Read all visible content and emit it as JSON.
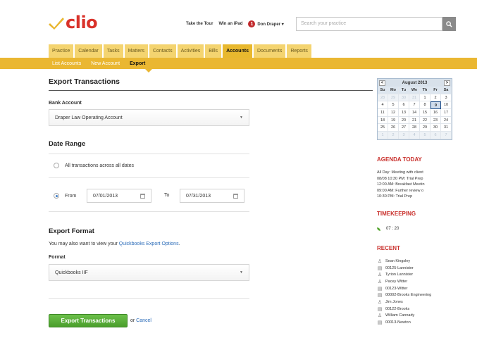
{
  "brand": {
    "name": "clio"
  },
  "top_links": {
    "tour": "Take the Tour",
    "win": "Win an iPad",
    "alert_count": "1",
    "user": "Don Draper ▾"
  },
  "search": {
    "placeholder": "Search your practice"
  },
  "tabs": [
    {
      "label": "Practice"
    },
    {
      "label": "Calendar"
    },
    {
      "label": "Tasks"
    },
    {
      "label": "Matters"
    },
    {
      "label": "Contacts"
    },
    {
      "label": "Activities"
    },
    {
      "label": "Bills"
    },
    {
      "label": "Accounts",
      "active": true
    },
    {
      "label": "Documents"
    },
    {
      "label": "Reports"
    }
  ],
  "subnav": [
    {
      "label": "List Accounts"
    },
    {
      "label": "New Account"
    },
    {
      "label": "Export",
      "active": true
    }
  ],
  "main": {
    "title": "Export Transactions",
    "bank_account_label": "Bank Account",
    "bank_account_value": "Draper Law Operating Account",
    "date_range_title": "Date Range",
    "all_dates_label": "All transactions across all dates",
    "from_label": "From",
    "from_value": "07/01/2013",
    "to_label": "To",
    "to_value": "07/31/2013",
    "export_format_title": "Export Format",
    "hint_prefix": "You may also want to view your ",
    "hint_link": "Quickbooks Export Options",
    "hint_suffix": ".",
    "format_label": "Format",
    "format_value": "Quickbooks IIF",
    "submit_label": "Export Transactions",
    "or_text": "or ",
    "cancel_label": "Cancel"
  },
  "calendar": {
    "month_label": "August 2013",
    "prev": "<",
    "next": ">",
    "dows": [
      "Su",
      "Mo",
      "Tu",
      "We",
      "Th",
      "Fr",
      "Sa"
    ],
    "weeks": [
      [
        {
          "d": "28",
          "m": true
        },
        {
          "d": "29",
          "m": true
        },
        {
          "d": "30",
          "m": true
        },
        {
          "d": "31",
          "m": true
        },
        {
          "d": "1"
        },
        {
          "d": "2"
        },
        {
          "d": "3"
        }
      ],
      [
        {
          "d": "4"
        },
        {
          "d": "5"
        },
        {
          "d": "6"
        },
        {
          "d": "7"
        },
        {
          "d": "8"
        },
        {
          "d": "9",
          "t": true
        },
        {
          "d": "10"
        }
      ],
      [
        {
          "d": "11"
        },
        {
          "d": "12"
        },
        {
          "d": "13"
        },
        {
          "d": "14"
        },
        {
          "d": "15"
        },
        {
          "d": "16"
        },
        {
          "d": "17"
        }
      ],
      [
        {
          "d": "18"
        },
        {
          "d": "19"
        },
        {
          "d": "20"
        },
        {
          "d": "21"
        },
        {
          "d": "22"
        },
        {
          "d": "23"
        },
        {
          "d": "24"
        }
      ],
      [
        {
          "d": "25"
        },
        {
          "d": "26"
        },
        {
          "d": "27"
        },
        {
          "d": "28"
        },
        {
          "d": "29"
        },
        {
          "d": "30"
        },
        {
          "d": "31"
        }
      ],
      [
        {
          "d": "1",
          "m": true
        },
        {
          "d": "2",
          "m": true
        },
        {
          "d": "3",
          "m": true
        },
        {
          "d": "4",
          "m": true
        },
        {
          "d": "5",
          "m": true
        },
        {
          "d": "6",
          "m": true
        },
        {
          "d": "7",
          "m": true
        }
      ]
    ]
  },
  "agenda": {
    "title": "AGENDA TODAY",
    "items": [
      "All Day: Meeting with client",
      "08/08 10:30 PM: Trial Prep",
      "12:00 AM: Breakfast Meetin",
      "09:00 AM: Further review o",
      "10:30 PM: Trial Prep"
    ]
  },
  "timekeeping": {
    "title": "TIMEKEEPING",
    "timer": "07 : 20"
  },
  "recent": {
    "title": "RECENT",
    "items": [
      {
        "label": "Sean Kingsley",
        "icon": "person-icon"
      },
      {
        "label": "00125-Lannister",
        "icon": "briefcase-icon"
      },
      {
        "label": "Tyrion Lannister",
        "icon": "person-icon"
      },
      {
        "label": "Pacey Witter",
        "icon": "person-icon"
      },
      {
        "label": "00123-Witter",
        "icon": "briefcase-icon"
      },
      {
        "label": "00002-Brooks Engineering",
        "icon": "briefcase-icon"
      },
      {
        "label": "Jim Jones",
        "icon": "person-icon"
      },
      {
        "label": "00122-Brooks",
        "icon": "briefcase-icon"
      },
      {
        "label": "William Cannady",
        "icon": "person-icon"
      },
      {
        "label": "00013-Newton",
        "icon": "briefcase-icon"
      }
    ]
  },
  "colors": {
    "brand_red": "#d9322a",
    "tab_yellow": "#f4d470",
    "subnav_gold": "#eab732",
    "button_green": "#5aae3a",
    "side_red": "#c9302c"
  }
}
